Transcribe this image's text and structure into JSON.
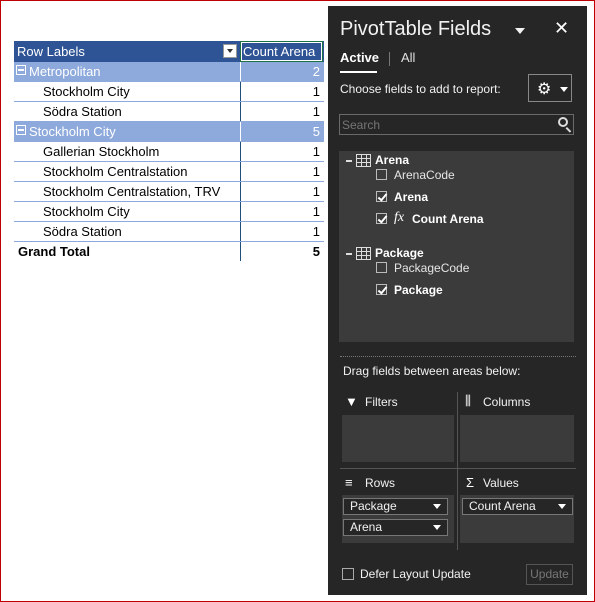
{
  "pivot": {
    "header": {
      "row_labels": "Row Labels",
      "count_arena": "Count Arena"
    },
    "groups": [
      {
        "name": "Metropolitan",
        "count": "2",
        "items": [
          {
            "name": "Stockholm City",
            "count": "1"
          },
          {
            "name": "Södra Station",
            "count": "1"
          }
        ]
      },
      {
        "name": "Stockholm City",
        "count": "5",
        "items": [
          {
            "name": "Gallerian Stockholm",
            "count": "1"
          },
          {
            "name": "Stockholm Centralstation",
            "count": "1"
          },
          {
            "name": "Stockholm Centralstation, TRV",
            "count": "1"
          },
          {
            "name": "Stockholm City",
            "count": "1"
          },
          {
            "name": "Södra Station",
            "count": "1"
          }
        ]
      }
    ],
    "grand_total": {
      "label": "Grand Total",
      "count": "5"
    },
    "colors": {
      "header_bg": "#2f5496",
      "group_bg": "#8ea9db",
      "border": "#8ea9db"
    }
  },
  "pane": {
    "title": "PivotTable Fields",
    "close_glyph": "✕",
    "tabs": {
      "active": "Active",
      "all": "All"
    },
    "choose_label": "Choose fields to add to report:",
    "gear_glyph": "⚙",
    "search_placeholder": "Search",
    "tables": [
      {
        "name": "Arena",
        "fields": [
          {
            "name": "ArenaCode",
            "checked": false
          },
          {
            "name": "Arena",
            "checked": true
          },
          {
            "name": "Count Arena",
            "checked": true,
            "fx": "fx"
          }
        ]
      },
      {
        "name": "Package",
        "fields": [
          {
            "name": "PackageCode",
            "checked": false
          },
          {
            "name": "Package",
            "checked": true
          }
        ]
      }
    ],
    "drag_label": "Drag fields between areas below:",
    "areas": {
      "filters": {
        "label": "Filters",
        "icon": "▼"
      },
      "columns": {
        "label": "Columns",
        "icon": "⫼"
      },
      "rows": {
        "label": "Rows",
        "icon": "≡",
        "chips": [
          "Package",
          "Arena"
        ]
      },
      "values": {
        "label": "Values",
        "icon": "Σ",
        "chips": [
          "Count Arena"
        ]
      }
    },
    "defer_label": "Defer Layout Update",
    "update_label": "Update",
    "colors": {
      "bg": "#262626",
      "panel": "#3b3b3b"
    }
  }
}
